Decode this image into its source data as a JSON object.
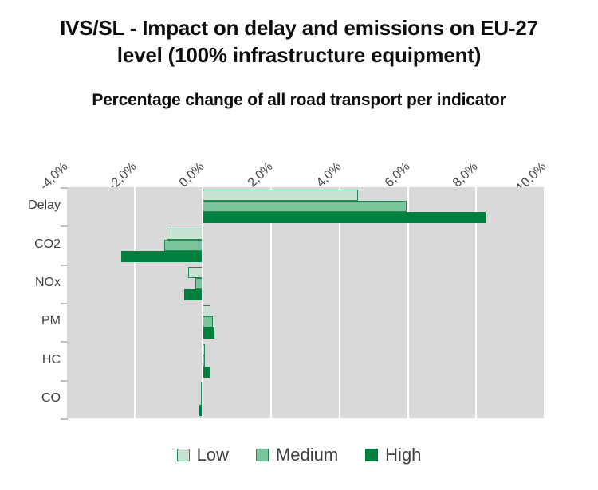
{
  "chart_data": {
    "type": "bar",
    "orientation": "horizontal",
    "title": "IVS/SL - Impact on delay and emissions on EU-27 level (100% infrastructure equipment)",
    "subtitle": "Percentage change of all road transport  per indicator",
    "xlabel": "",
    "ylabel": "",
    "categories": [
      "Delay",
      "CO2",
      "NOx",
      "PM",
      "HC",
      "CO"
    ],
    "series": [
      {
        "name": "Low",
        "color": "#C8E2D0",
        "values": [
          4.55,
          -1.07,
          -0.42,
          0.23,
          0.07,
          -0.05
        ]
      },
      {
        "name": "Medium",
        "color": "#7CC49B",
        "values": [
          5.97,
          -1.14,
          -0.21,
          0.3,
          0.07,
          -0.05
        ]
      },
      {
        "name": "High",
        "color": "#00803F",
        "values": [
          8.28,
          -2.38,
          -0.54,
          0.35,
          0.19,
          -0.1
        ]
      }
    ],
    "xlim": [
      -4.0,
      10.0
    ],
    "xticks": [
      -4.0,
      -2.0,
      0.0,
      2.0,
      4.0,
      6.0,
      8.0,
      10.0
    ],
    "xtick_labels": [
      "-4,0%",
      "-2,0%",
      "0,0%",
      "2,0%",
      "4,0%",
      "6,0%",
      "8,0%",
      "10,0%"
    ],
    "grid": true,
    "grid_color": "#FFFFFF",
    "plot_background": "#D9D9D9",
    "legend_position": "bottom",
    "legend_entries": [
      "Low",
      "Medium",
      "High"
    ]
  },
  "legend": {
    "items": [
      {
        "label": "Low"
      },
      {
        "label": "Medium"
      },
      {
        "label": "High"
      }
    ]
  }
}
